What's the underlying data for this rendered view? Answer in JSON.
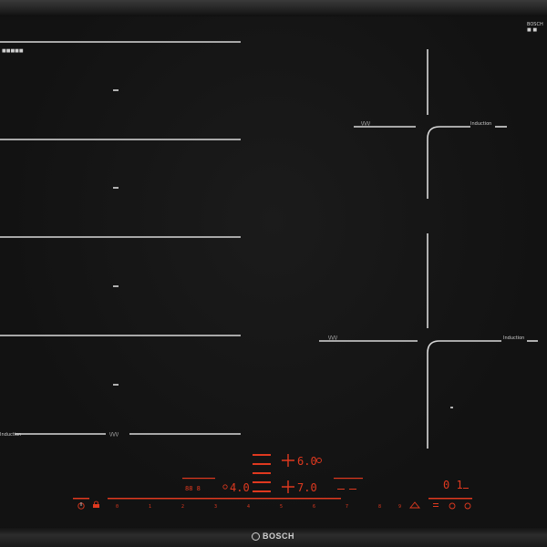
{
  "brand": {
    "logo_text": "BOSCH",
    "corner_label": "BOSCH"
  },
  "zones_left": {
    "bottom_label_induction": "Induction",
    "bottom_label_wave": "\\/\\/\\/"
  },
  "zones_right": {
    "top": {
      "wave_label": "\\/\\/\\/",
      "induction_label": "Induction"
    },
    "bottom": {
      "wave_label": "\\/\\/\\/",
      "induction_label": "Induction"
    }
  },
  "display": {
    "upper_power": "6.0",
    "lower_power": "7.0",
    "timer": "4.0",
    "right_readout": "0 1",
    "left_left_digits": "88 8"
  },
  "slider": {
    "ticks": [
      "0",
      "1",
      "2",
      "3",
      "4",
      "5",
      "6",
      "7",
      "8",
      "9"
    ]
  },
  "colors": {
    "accent": "#e0391f",
    "line": "#d9d9d9",
    "glass": "#141414"
  },
  "icons": [
    "power-icon",
    "lock-icon",
    "timer-icon",
    "boost-icon",
    "menu-icon",
    "wifi-icon",
    "settings-icon"
  ]
}
